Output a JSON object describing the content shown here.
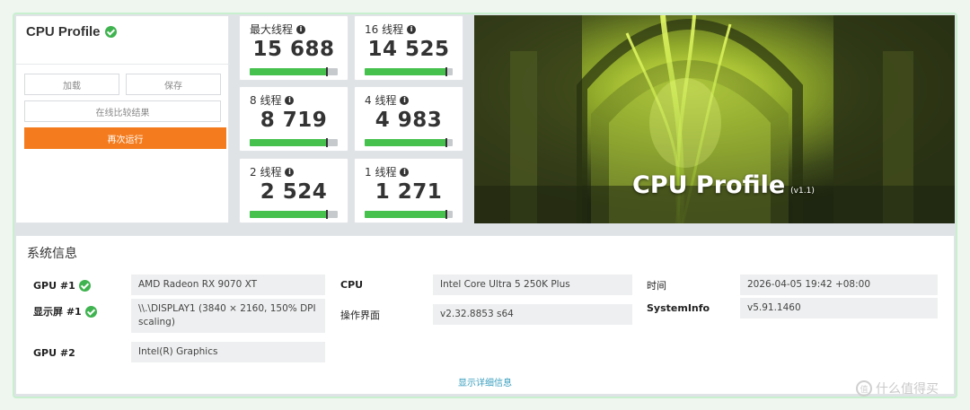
{
  "profile": {
    "title": "CPU Profile",
    "buttons": {
      "load": "加载",
      "save": "保存",
      "compare": "在线比较结果",
      "run_again": "再次运行"
    }
  },
  "scores": [
    {
      "label": "最大线程",
      "score": "15 688",
      "progress": 0.88
    },
    {
      "label": "16 线程",
      "score": "14 525",
      "progress": 0.93
    },
    {
      "label": "8 线程",
      "score": "8 719",
      "progress": 0.88
    },
    {
      "label": "4 线程",
      "score": "4 983",
      "progress": 0.93
    },
    {
      "label": "2 线程",
      "score": "2 524",
      "progress": 0.88
    },
    {
      "label": "1 线程",
      "score": "1 271",
      "progress": 0.93
    }
  ],
  "hero": {
    "title": "CPU Profile",
    "version": "(v1.1)"
  },
  "system_info": {
    "title": "系统信息",
    "gpu1_label": "GPU #1",
    "gpu1_value": "AMD Radeon RX 9070 XT",
    "display1_label": "显示屏 #1",
    "display1_value": "\\\\.\\DISPLAY1 (3840 × 2160, 150% DPI scaling)",
    "gpu2_label": "GPU #2",
    "gpu2_value": "Intel(R) Graphics",
    "cpu_label": "CPU",
    "cpu_value": "Intel Core Ultra 5 250K Plus",
    "ui_label": "操作界面",
    "ui_value": "v2.32.8853 s64",
    "time_label": "时间",
    "time_value": "2026-04-05 19:42 +08:00",
    "systeminfo_label": "SystemInfo",
    "systeminfo_value": "v5.91.1460",
    "details_link": "显示详细信息"
  },
  "watermark": {
    "logo": "值",
    "text": "什么值得买"
  },
  "colors": {
    "accent_orange": "#f47c1e",
    "bar_green": "#46c14e",
    "check_green": "#3fb34f",
    "link_blue": "#3a9fbf"
  }
}
